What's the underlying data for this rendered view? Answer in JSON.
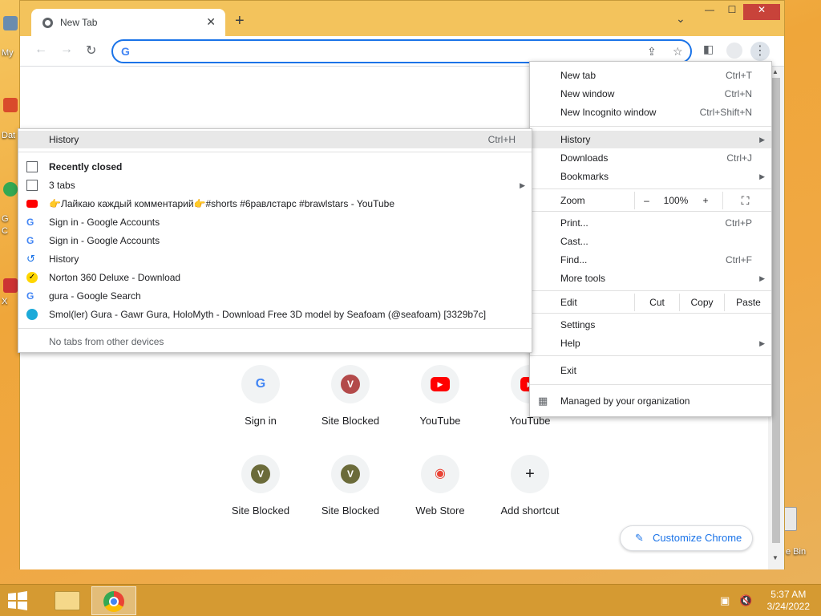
{
  "desktop": {
    "labels": [
      "My",
      "Dat",
      "G",
      "C",
      "X"
    ],
    "recycle_label": "e Bin"
  },
  "window": {
    "tab_title": "New Tab",
    "tab_close": "✕",
    "new_tab": "+",
    "tab_search": "⌄",
    "minimize": "—",
    "maximize": "☐",
    "close": "✕"
  },
  "toolbar": {
    "back": "←",
    "forward": "→",
    "reload": "↻",
    "omnibox_value": "",
    "omnibox_placeholder": "",
    "google_g": "G"
  },
  "shortcuts": [
    {
      "label": "Sign in",
      "letter": "G",
      "color": "#4285f4"
    },
    {
      "label": "Site Blocked",
      "letter": "V",
      "color": "#b34a4a"
    },
    {
      "label": "YouTube",
      "letter": "▶",
      "color": "#ff0000"
    },
    {
      "label": "YouTube",
      "letter": "▶",
      "color": "#ff0000"
    },
    {
      "label": "Site Blocked",
      "letter": "V",
      "color": "#6b6b3a"
    },
    {
      "label": "Site Blocked",
      "letter": "V",
      "color": "#6b6b3a"
    },
    {
      "label": "Web Store",
      "letter": "◉",
      "color": "#34a853"
    },
    {
      "label": "Add shortcut",
      "letter": "+",
      "color": "#202124"
    }
  ],
  "customize": {
    "label": "Customize Chrome"
  },
  "chrome_menu": {
    "new_tab": {
      "label": "New tab",
      "key": "Ctrl+T"
    },
    "new_window": {
      "label": "New window",
      "key": "Ctrl+N"
    },
    "incognito": {
      "label": "New Incognito window",
      "key": "Ctrl+Shift+N"
    },
    "history": {
      "label": "History"
    },
    "downloads": {
      "label": "Downloads",
      "key": "Ctrl+J"
    },
    "bookmarks": {
      "label": "Bookmarks"
    },
    "zoom": {
      "label": "Zoom",
      "minus": "–",
      "value": "100%",
      "plus": "+",
      "fullscreen": "⛶"
    },
    "print": {
      "label": "Print...",
      "key": "Ctrl+P"
    },
    "cast": {
      "label": "Cast..."
    },
    "find": {
      "label": "Find...",
      "key": "Ctrl+F"
    },
    "more_tools": {
      "label": "More tools"
    },
    "edit": {
      "label": "Edit",
      "cut": "Cut",
      "copy": "Copy",
      "paste": "Paste"
    },
    "settings": {
      "label": "Settings"
    },
    "help": {
      "label": "Help"
    },
    "exit": {
      "label": "Exit"
    },
    "managed": {
      "label": "Managed by your organization"
    }
  },
  "history_menu": {
    "history": {
      "label": "History",
      "key": "Ctrl+H"
    },
    "recently_closed": "Recently closed",
    "items": [
      {
        "label": "3 tabs",
        "icon": "window-icon"
      },
      {
        "label": "👉Лайкаю каждый комментарий👉#shorts #6равлстарс #brawlstars - YouTube",
        "icon": "youtube-icon"
      },
      {
        "label": "Sign in - Google Accounts",
        "icon": "google-icon"
      },
      {
        "label": "Sign in - Google Accounts",
        "icon": "google-icon"
      },
      {
        "label": "History",
        "icon": "history-icon"
      },
      {
        "label": "Norton 360 Deluxe - Download",
        "icon": "norton-icon"
      },
      {
        "label": "gura - Google Search",
        "icon": "google-icon"
      },
      {
        "label": "Smol(ler) Gura - Gawr Gura, HoloMyth - Download Free 3D model by Seafoam (@seafoam) [3329b7c]",
        "icon": "sketchfab-icon"
      }
    ],
    "no_tabs": "No tabs from other devices"
  },
  "taskbar": {
    "time": "5:37 AM",
    "date": "3/24/2022"
  }
}
